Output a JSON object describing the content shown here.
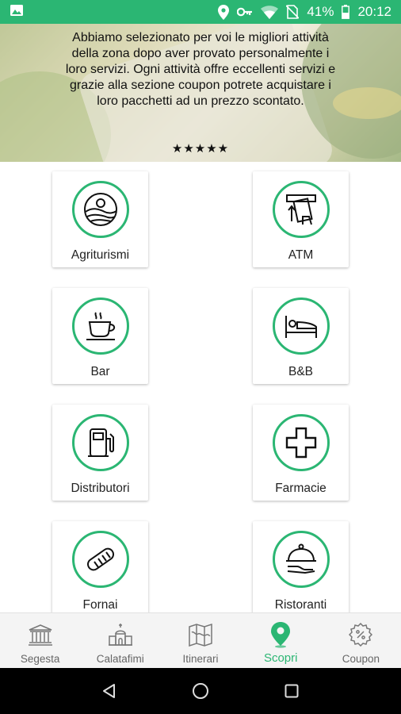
{
  "status_bar": {
    "battery": "41%",
    "time": "20:12",
    "icons": [
      "image-icon",
      "location-icon",
      "key-icon",
      "wifi-icon",
      "no-sim-icon",
      "battery-icon"
    ]
  },
  "hero": {
    "text": "Abbiamo selezionato per voi le migliori attività della zona dopo aver provato personalmente i loro servizi. Ogni attività offre eccellenti servizi e grazie alla sezione coupon potrete acquistare i loro pacchetti ad un prezzo scontato.",
    "stars": "★★★★★"
  },
  "categories": [
    {
      "label": "Agriturismi",
      "icon": "farm-landscape-icon"
    },
    {
      "label": "ATM",
      "icon": "atm-card-icon"
    },
    {
      "label": "Bar",
      "icon": "coffee-cup-icon"
    },
    {
      "label": "B&B",
      "icon": "bed-icon"
    },
    {
      "label": "Distributori",
      "icon": "fuel-pump-icon"
    },
    {
      "label": "Farmacie",
      "icon": "pharmacy-cross-icon"
    },
    {
      "label": "Fornai",
      "icon": "bread-icon"
    },
    {
      "label": "Ristoranti",
      "icon": "restaurant-cloche-icon"
    }
  ],
  "bottom_nav": [
    {
      "label": "Segesta",
      "icon": "temple-icon",
      "active": false
    },
    {
      "label": "Calatafimi",
      "icon": "church-icon",
      "active": false
    },
    {
      "label": "Itinerari",
      "icon": "map-icon",
      "active": false
    },
    {
      "label": "Scopri",
      "icon": "location-pin-icon",
      "active": true
    },
    {
      "label": "Coupon",
      "icon": "coupon-badge-icon",
      "active": false
    }
  ],
  "colors": {
    "accent": "#2bb673",
    "status_bar": "#2bb673",
    "nav_inactive": "#666666"
  }
}
